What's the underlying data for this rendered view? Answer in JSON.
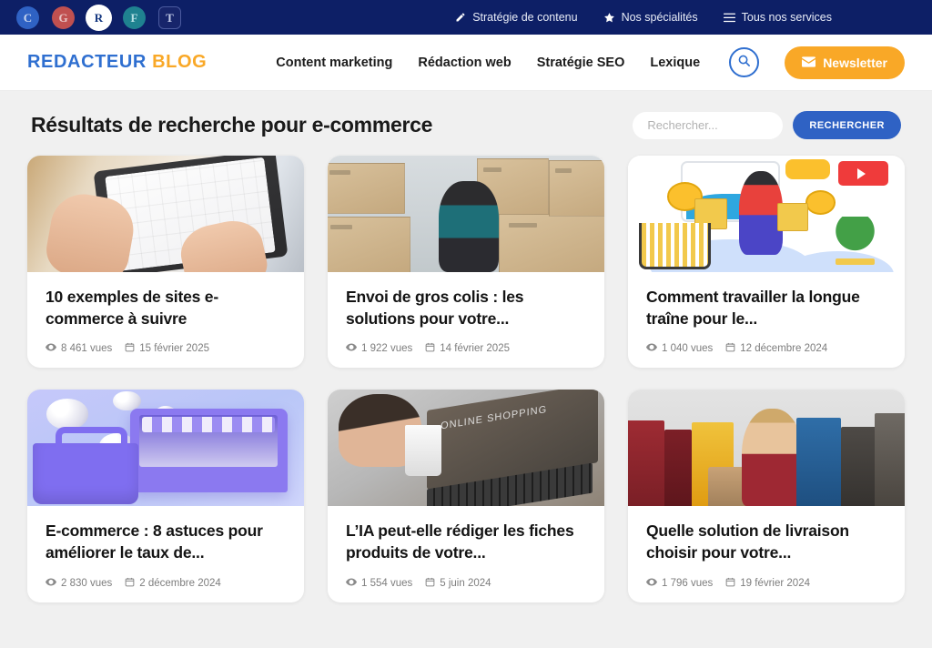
{
  "topbar": {
    "brand_icons": [
      {
        "name": "brand-icon-c",
        "letter": "C",
        "class": "bi-c"
      },
      {
        "name": "brand-icon-g",
        "letter": "G",
        "class": "bi-g"
      },
      {
        "name": "brand-icon-r",
        "letter": "R",
        "class": "bi-r"
      },
      {
        "name": "brand-icon-f",
        "letter": "F",
        "class": "bi-f"
      },
      {
        "name": "brand-icon-t",
        "letter": "T",
        "class": "bi-t"
      }
    ],
    "links": [
      {
        "label": "Stratégie de contenu",
        "icon": "pencil-icon"
      },
      {
        "label": "Nos spécialités",
        "icon": "star-icon"
      },
      {
        "label": "Tous nos services",
        "icon": "hamburger-icon"
      }
    ],
    "background": "#0d1f66"
  },
  "header": {
    "logo": {
      "part1": "REDACTEUR",
      "part2": "BLOG"
    },
    "nav": [
      {
        "label": "Content marketing"
      },
      {
        "label": "Rédaction web"
      },
      {
        "label": "Stratégie SEO"
      },
      {
        "label": "Lexique"
      }
    ],
    "search_icon": "search-icon",
    "newsletter_label": "Newsletter",
    "newsletter_icon": "envelope-icon",
    "accent_blue": "#2f6fd0",
    "accent_orange": "#f9a827"
  },
  "results": {
    "title": "Résultats de recherche pour e-commerce",
    "search_placeholder": "Rechercher...",
    "search_value": "",
    "search_button_label": "RECHERCHER",
    "search_button_color": "#2f62c4"
  },
  "cards": [
    {
      "title": "10 exemples de sites e-commerce à suivre",
      "views": "8 461 vues",
      "date": "15 février 2025",
      "thumb_class": "th1",
      "thumb_alt": "mains-sur-tablette-shopping"
    },
    {
      "title": "Envoi de gros colis : les solutions pour votre...",
      "views": "1 922 vues",
      "date": "14 février 2025",
      "thumb_class": "th2",
      "thumb_alt": "homme-avec-cartons"
    },
    {
      "title": "Comment travailler la longue traîne pour le...",
      "views": "1 040 vues",
      "date": "12 décembre 2024",
      "thumb_class": "th3",
      "thumb_alt": "illustration-shopping-vectorielle"
    },
    {
      "title": "E-commerce : 8 astuces pour améliorer le taux de...",
      "views": "2 830 vues",
      "date": "2 décembre 2024",
      "thumb_class": "th4",
      "thumb_alt": "rendu-3d-boutique-violette"
    },
    {
      "title": "L’IA peut-elle rédiger les fiches produits de votre...",
      "views": "1 554 vues",
      "date": "5 juin 2024",
      "thumb_class": "th5",
      "thumb_alt": "homme-ordinateur-online-shopping"
    },
    {
      "title": "Quelle solution de livraison choisir pour votre...",
      "views": "1 796 vues",
      "date": "19 février 2024",
      "thumb_class": "th6",
      "thumb_alt": "femme-sacs-de-shopping"
    }
  ],
  "meta_icons": {
    "views": "eye-icon",
    "date": "calendar-icon"
  }
}
